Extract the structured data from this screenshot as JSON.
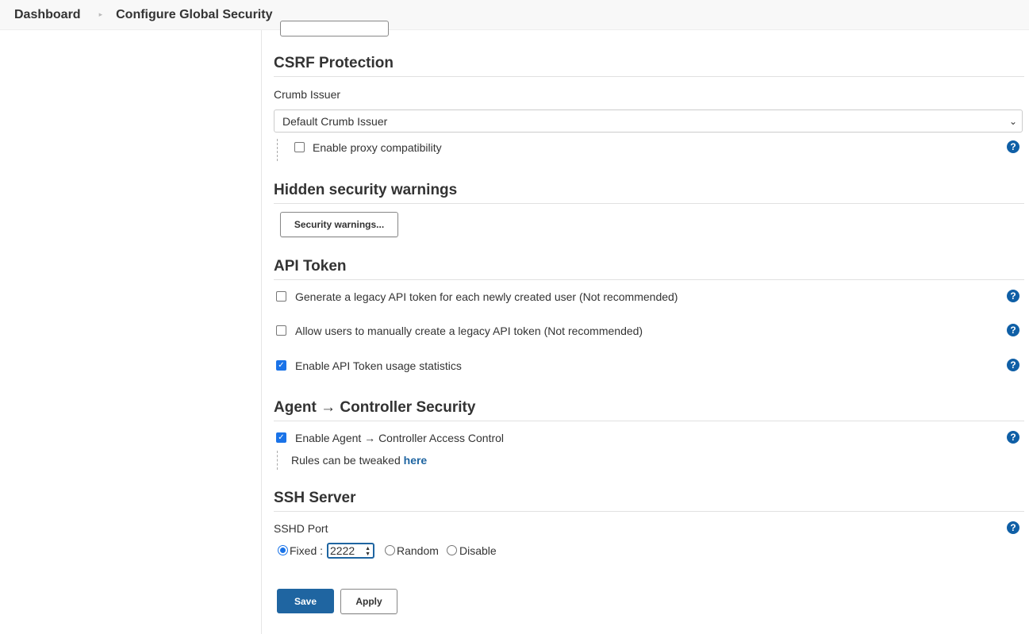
{
  "breadcrumb": {
    "home": "Dashboard",
    "separator": "▸",
    "current": "Configure Global Security"
  },
  "csrf": {
    "heading": "CSRF Protection",
    "crumb_issuer_label": "Crumb Issuer",
    "crumb_issuer_value": "Default Crumb Issuer",
    "proxy_compat_label": "Enable proxy compatibility",
    "proxy_compat_checked": false
  },
  "hidden_warnings": {
    "heading": "Hidden security warnings",
    "button_label": "Security warnings..."
  },
  "api_token": {
    "heading": "API Token",
    "options": [
      {
        "label": "Generate a legacy API token for each newly created user (Not recommended)",
        "checked": false
      },
      {
        "label": "Allow users to manually create a legacy API token (Not recommended)",
        "checked": false
      },
      {
        "label": "Enable API Token usage statistics",
        "checked": true
      }
    ]
  },
  "agent_security": {
    "heading": "Agent → Controller Security",
    "access_control_label": "Enable Agent → Controller Access Control",
    "access_control_checked": true,
    "rules_text": "Rules can be tweaked ",
    "rules_link": "here"
  },
  "ssh": {
    "heading": "SSH Server",
    "port_label": "SSHD Port",
    "fixed_label": "Fixed :",
    "port_value": "2222",
    "random_label": "Random",
    "disable_label": "Disable",
    "selected": "fixed"
  },
  "actions": {
    "save_label": "Save",
    "apply_label": "Apply"
  },
  "icons": {
    "help": "?",
    "check": "✓",
    "chevron_down": "⌄",
    "stepper_up": "▲",
    "stepper_down": "▼"
  },
  "colors": {
    "primary": "#1f65a1",
    "help_icon": "#0f5fa6",
    "checkbox_checked": "#1a73e8"
  }
}
